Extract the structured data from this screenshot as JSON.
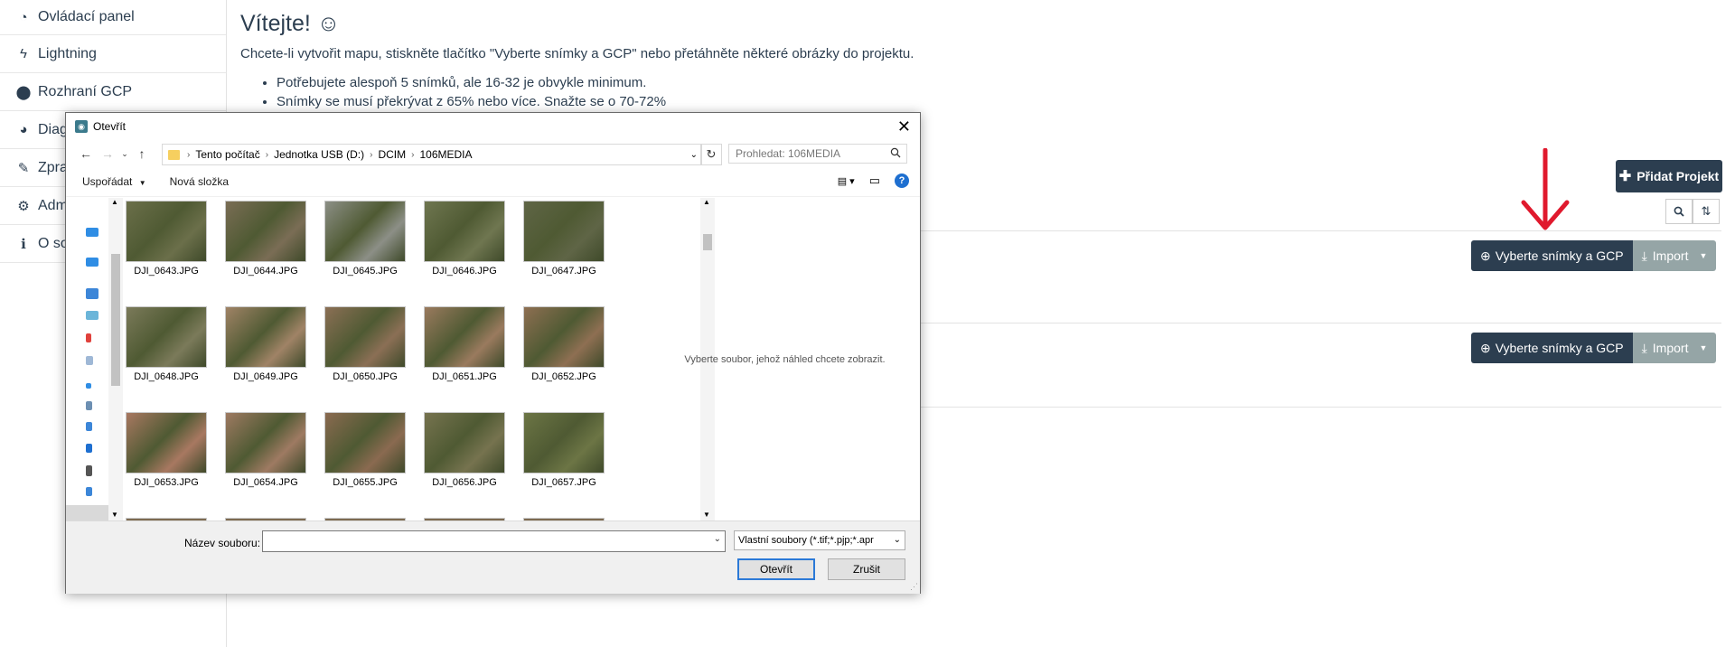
{
  "sidebar": {
    "items": [
      {
        "label": "Ovládací panel",
        "icon": "dashboard-icon",
        "glyph": "◔"
      },
      {
        "label": "Lightning",
        "icon": "bolt-icon",
        "glyph": "ϟ"
      },
      {
        "label": "Rozhraní GCP",
        "icon": "map-marker-icon",
        "glyph": "⬤"
      },
      {
        "label": "Diagr",
        "icon": "pie-chart-icon",
        "glyph": "◕"
      },
      {
        "label": "Zprac",
        "icon": "wrench-icon",
        "glyph": "✎"
      },
      {
        "label": "Admi",
        "icon": "cogs-icon",
        "glyph": "⚙"
      },
      {
        "label": "O sof",
        "icon": "info-circle-icon",
        "glyph": "ℹ"
      }
    ]
  },
  "main": {
    "welcome": "Vítejte! ☺",
    "lead": "Chcete-li vytvořit mapu, stiskněte tlačítko \"Vyberte snímky a GCP\" nebo přetáhněte některé obrázky do projektu.",
    "tips": [
      "Potřebujete alespoň 5 snímků, ale 16-32 je obvykle minimum.",
      "Snímky se musí překrývat z 65% nebo více. Snažte se o 70-72%"
    ],
    "add_project": "Přidat Projekt",
    "projects": [
      {
        "select_label": "Vyberte snímky a GCP",
        "import_label": "Import"
      },
      {
        "select_label": "Vyberte snímky a GCP",
        "import_label": "Import"
      }
    ]
  },
  "dialog": {
    "title": "Otevřít",
    "breadcrumb": [
      "Tento počítač",
      "Jednotka USB (D:)",
      "DCIM",
      "106MEDIA"
    ],
    "search_placeholder": "Prohledat: 106MEDIA",
    "organize": "Uspořádat",
    "new_folder": "Nová složka",
    "files": [
      {
        "name": "DJI_0643.JPG",
        "tone": "#6b6f4a"
      },
      {
        "name": "DJI_0644.JPG",
        "tone": "#7a6d55"
      },
      {
        "name": "DJI_0645.JPG",
        "tone": "#8c8f86"
      },
      {
        "name": "DJI_0646.JPG",
        "tone": "#6f7650"
      },
      {
        "name": "DJI_0647.JPG",
        "tone": "#5f6546"
      },
      {
        "name": "DJI_0648.JPG",
        "tone": "#7b7a5a"
      },
      {
        "name": "DJI_0649.JPG",
        "tone": "#a08366"
      },
      {
        "name": "DJI_0650.JPG",
        "tone": "#8b6f55"
      },
      {
        "name": "DJI_0651.JPG",
        "tone": "#9a7a5e"
      },
      {
        "name": "DJI_0652.JPG",
        "tone": "#8e6f52"
      },
      {
        "name": "DJI_0653.JPG",
        "tone": "#a87861"
      },
      {
        "name": "DJI_0654.JPG",
        "tone": "#9e7a62"
      },
      {
        "name": "DJI_0655.JPG",
        "tone": "#8a6a50"
      },
      {
        "name": "DJI_0656.JPG",
        "tone": "#76734f"
      },
      {
        "name": "DJI_0657.JPG",
        "tone": "#6c7545"
      }
    ],
    "preview_text": "Vyberte soubor, jehož náhled chcete zobrazit.",
    "filename_label": "Název souboru:",
    "filename_value": "",
    "filter": "Vlastní soubory (*.tif;*.pjp;*.apr",
    "open": "Otevřít",
    "cancel": "Zrušit"
  },
  "colors": {
    "primary": "#2c3e50",
    "secondary": "#95a5a6",
    "arrow": "#e0192d",
    "focus": "#2b79d7"
  }
}
